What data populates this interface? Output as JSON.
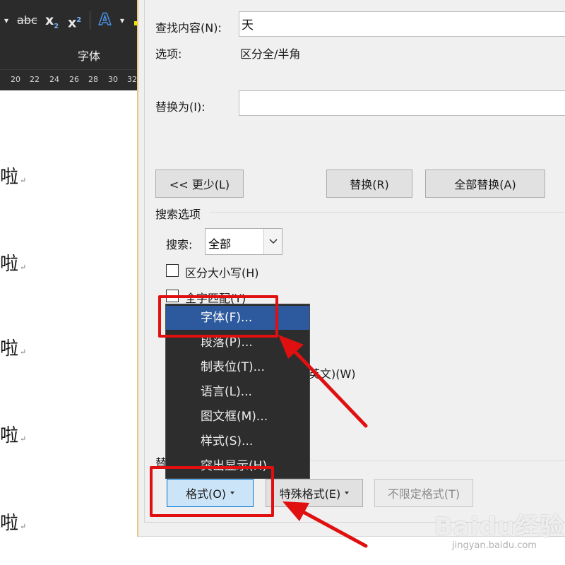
{
  "ribbon": {
    "dropdown_arrow": "▾",
    "strike": "abc",
    "subscript": "x",
    "subscript_mark": "2",
    "superscript": "x",
    "superscript_mark": "2",
    "text_effect": "A",
    "group_label": "字体",
    "ruler_ticks": [
      "20",
      "22",
      "24",
      "26",
      "28",
      "30",
      "32"
    ]
  },
  "document": {
    "lines": [
      "啦",
      "啦",
      "啦",
      "啦",
      "啦"
    ],
    "para_mark": "↵"
  },
  "dialog": {
    "find_label": "查找内容(N):",
    "find_value": "天",
    "options_label": "选项:",
    "options_value": "区分全/半角",
    "replace_label": "替换为(I):",
    "replace_value": "",
    "less_button": "<< 更少(L)",
    "replace_button": "替换(R)",
    "replace_all_button": "全部替换(A)",
    "search_options_title": "搜索选项",
    "search_label": "搜索:",
    "search_value": "全部",
    "match_case": "区分大小写(H)",
    "whole_word": "全字匹配(Y)",
    "partial_option": "英文)(W)",
    "replace_section_partial": "替",
    "format_button": "格式(O)",
    "special_button": "特殊格式(E)",
    "no_format_button": "不限定格式(T)"
  },
  "format_menu": {
    "items": [
      "字体(F)...",
      "段落(P)...",
      "制表位(T)...",
      "语言(L)...",
      "图文框(M)...",
      "样式(S)...",
      "突出显示(H)"
    ],
    "highlighted_index": 0
  },
  "watermark": {
    "brand": "Baidu经验",
    "url": "jingyan.baidu.com"
  },
  "colors": {
    "annotation_red": "#e01010",
    "menu_highlight": "#2d5a9e",
    "ribbon_bg": "#2b2b2b"
  }
}
